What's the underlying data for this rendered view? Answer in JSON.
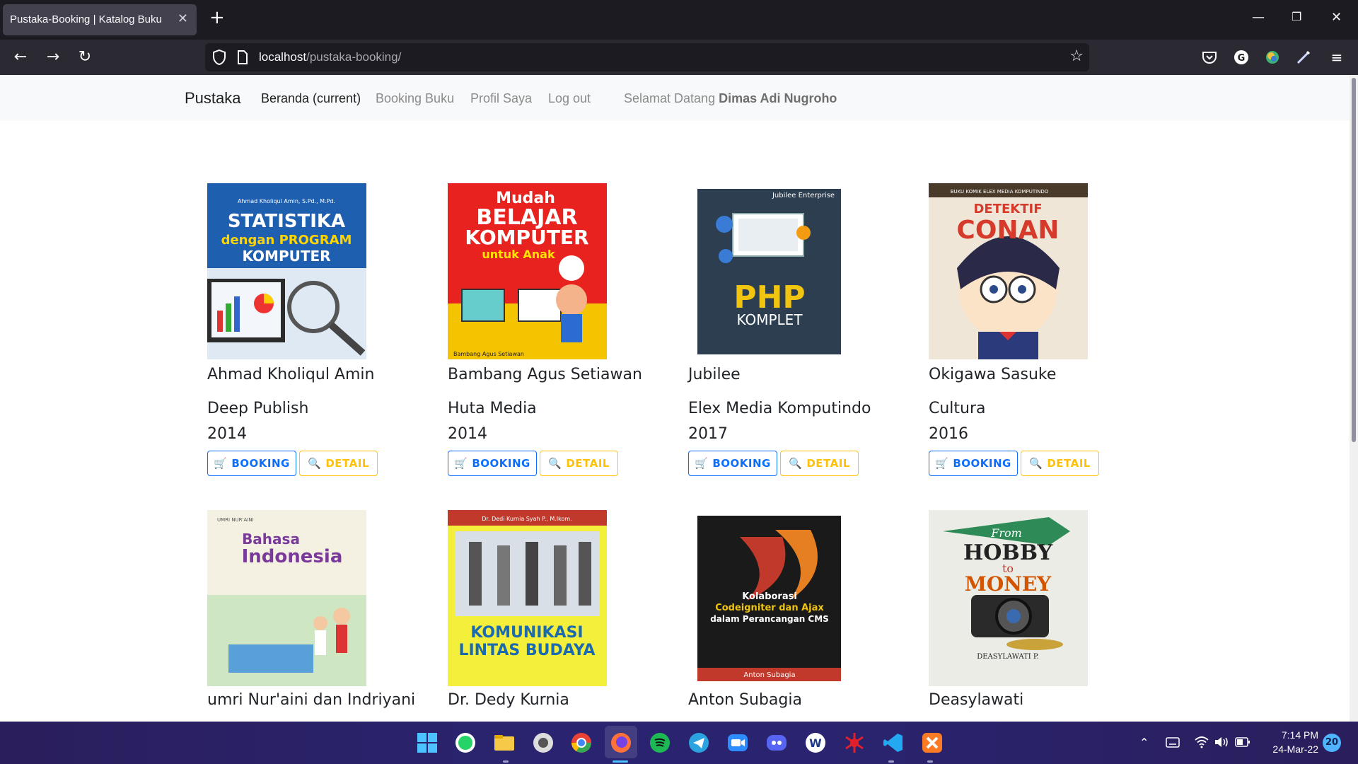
{
  "browser": {
    "tab_title": "Pustaka-Booking | Katalog Buku",
    "url_host": "localhost",
    "url_path": "/pustaka-booking/"
  },
  "site": {
    "brand": "Pustaka",
    "nav": [
      {
        "label": "Beranda (current)"
      },
      {
        "label": "Booking Buku"
      },
      {
        "label": "Profil Saya"
      },
      {
        "label": "Log out"
      }
    ],
    "welcome_prefix": "Selamat Datang",
    "user_name": "Dimas Adi Nugroho"
  },
  "buttons": {
    "booking": "BOOKING",
    "detail": "DETAIL"
  },
  "books": [
    {
      "cover_text": [
        "STATISTIKA",
        "dengan PROGRAM",
        "KOMPUTER"
      ],
      "cover_top": "Ahmad Kholiqul Amin, S.Pd., M.Pd.",
      "author": "Ahmad Kholiqul Amin",
      "publisher": "Deep Publish",
      "year": "2014"
    },
    {
      "cover_text": [
        "Mudah",
        "BELAJAR",
        "KOMPUTER",
        "untuk Anak"
      ],
      "cover_top": "Bambang Agus Setiawan",
      "author": "Bambang Agus Setiawan",
      "publisher": "Huta Media",
      "year": "2014"
    },
    {
      "cover_text": [
        "PHP",
        "KOMPLET"
      ],
      "cover_top": "Jubilee Enterprise",
      "author": "Jubilee",
      "publisher": "Elex Media Komputindo",
      "year": "2017"
    },
    {
      "cover_text": [
        "DETEKTIF",
        "CONAN"
      ],
      "cover_top": "BUKU KOMIK ELEX MEDIA KOMPUTINDO",
      "author": "Okigawa Sasuke",
      "publisher": "Cultura",
      "year": "2016"
    },
    {
      "cover_text": [
        "Bahasa",
        "Indonesia"
      ],
      "cover_top": "UMRI NUR'AINI",
      "author": "umri Nur'aini dan Indriyani"
    },
    {
      "cover_text": [
        "KOMUNIKASI",
        "LINTAS BUDAYA"
      ],
      "cover_top": "Dr. Dedi Kurnia Syah P., M.Ikom.",
      "author": "Dr. Dedy Kurnia"
    },
    {
      "cover_text": [
        "Kolaborasi",
        "Codeigniter dan Ajax",
        "dalam Perancangan CMS"
      ],
      "cover_top": "Anton Subagia",
      "author": "Anton Subagia"
    },
    {
      "cover_text": [
        "From",
        "HOBBY",
        "to",
        "MONEY"
      ],
      "cover_top": "DEASYLAWATI P.",
      "author": "Deasylawati"
    }
  ],
  "taskbar": {
    "time": "7:14 PM",
    "date": "24-Mar-22",
    "notifications": "20"
  }
}
